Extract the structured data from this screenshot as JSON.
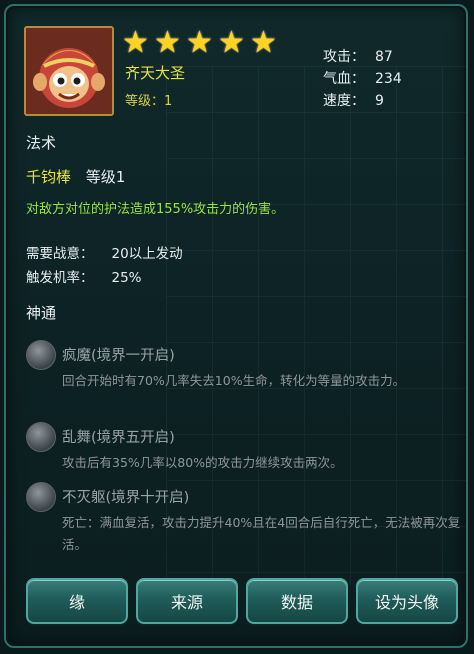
{
  "hero": {
    "name": "齐天大圣",
    "level": "等级：1",
    "stars": [
      "★",
      "★",
      "★",
      "★",
      "★"
    ]
  },
  "stats": [
    {
      "label": "攻击：",
      "value": "87"
    },
    {
      "label": "气血：",
      "value": "234"
    },
    {
      "label": "速度：",
      "value": "9"
    }
  ],
  "skill": {
    "section_title": "法术",
    "name": "千钧棒",
    "level": "等级1",
    "desc": "对敌方对位的护法造成155%攻击力的伤害。",
    "req": [
      {
        "label": "需要战意：",
        "value": "20以上发动"
      },
      {
        "label": "触发机率：",
        "value": "25%"
      }
    ]
  },
  "abilities_title": "神通",
  "abilities": [
    {
      "name": "疯魔(境界一开启)",
      "desc": "回合开始时有70%几率失去10%生命，转化为等量的攻击力。"
    },
    {
      "name": "乱舞(境界五开启)",
      "desc": "攻击后有35%几率以80%的攻击力继续攻击两次。"
    },
    {
      "name": "不灭躯(境界十开启)",
      "desc": "死亡：满血复活，攻击力提升40%且在4回合后自行死亡，无法被再次复活。"
    }
  ],
  "buttons": [
    "缘",
    "来源",
    "数据",
    "设为头像"
  ],
  "colors": {
    "name": "#e9e33a",
    "desc": "#9be24a",
    "stat": "#e8eef0",
    "button": "#1f5c59",
    "star": "#ffd322"
  }
}
